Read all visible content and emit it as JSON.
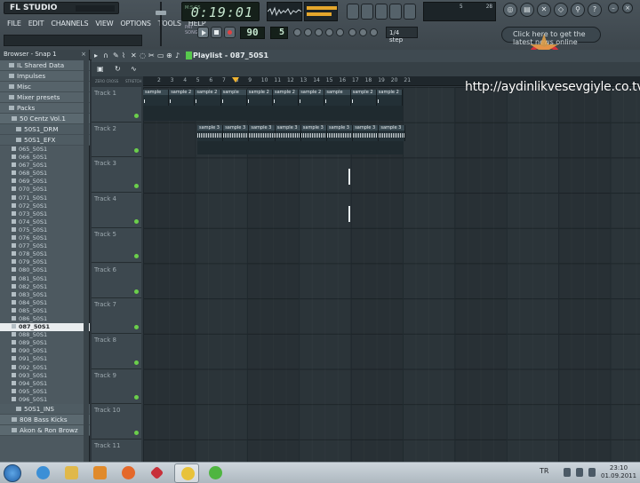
{
  "app": {
    "logo_text": "FL STUDIO",
    "menus": [
      "FILE",
      "EDIT",
      "CHANNELS",
      "VIEW",
      "OPTIONS",
      "TOOLS",
      "HELP"
    ]
  },
  "transport": {
    "song_time": "0:19:01",
    "song_time_label": "M:S:CS",
    "tempo": "90",
    "pattern": "5",
    "snap": "1/4 step",
    "monitor_left": "5",
    "monitor_right": "28",
    "pattern_mode_label": "PAT SONG",
    "online_text": "Click here to get the latest news online"
  },
  "browser": {
    "title": "Browser - Snap 1",
    "items": [
      {
        "label": "IL Shared Data",
        "kind": "folder"
      },
      {
        "label": "Impulses",
        "kind": "folder"
      },
      {
        "label": "Misc",
        "kind": "folder"
      },
      {
        "label": "Mixer presets",
        "kind": "folder"
      },
      {
        "label": "Packs",
        "kind": "folder"
      },
      {
        "label": "50 Centz Vol.1",
        "kind": "pack"
      },
      {
        "label": "50S1_DRM",
        "kind": "sub"
      },
      {
        "label": "50S1_EFX",
        "kind": "sub"
      },
      {
        "label": "065_50S1",
        "kind": "file"
      },
      {
        "label": "066_50S1",
        "kind": "file"
      },
      {
        "label": "067_50S1",
        "kind": "file"
      },
      {
        "label": "068_50S1",
        "kind": "file"
      },
      {
        "label": "069_50S1",
        "kind": "file"
      },
      {
        "label": "070_50S1",
        "kind": "file"
      },
      {
        "label": "071_50S1",
        "kind": "file"
      },
      {
        "label": "072_50S1",
        "kind": "file"
      },
      {
        "label": "073_50S1",
        "kind": "file"
      },
      {
        "label": "074_50S1",
        "kind": "file"
      },
      {
        "label": "075_50S1",
        "kind": "file"
      },
      {
        "label": "076_50S1",
        "kind": "file"
      },
      {
        "label": "077_50S1",
        "kind": "file"
      },
      {
        "label": "078_50S1",
        "kind": "file"
      },
      {
        "label": "079_50S1",
        "kind": "file"
      },
      {
        "label": "080_50S1",
        "kind": "file"
      },
      {
        "label": "081_50S1",
        "kind": "file"
      },
      {
        "label": "082_50S1",
        "kind": "file"
      },
      {
        "label": "083_50S1",
        "kind": "file"
      },
      {
        "label": "084_50S1",
        "kind": "file"
      },
      {
        "label": "085_50S1",
        "kind": "file"
      },
      {
        "label": "086_50S1",
        "kind": "file"
      },
      {
        "label": "087_50S1",
        "kind": "selected"
      },
      {
        "label": "088_50S1",
        "kind": "file"
      },
      {
        "label": "089_50S1",
        "kind": "file"
      },
      {
        "label": "090_50S1",
        "kind": "file"
      },
      {
        "label": "091_50S1",
        "kind": "file"
      },
      {
        "label": "092_50S1",
        "kind": "file"
      },
      {
        "label": "093_50S1",
        "kind": "file"
      },
      {
        "label": "094_50S1",
        "kind": "file"
      },
      {
        "label": "095_50S1",
        "kind": "file"
      },
      {
        "label": "096_50S1",
        "kind": "file"
      },
      {
        "label": "50S1_INS",
        "kind": "sub"
      },
      {
        "label": "808 Bass Kicks",
        "kind": "pack"
      },
      {
        "label": "Akon & Ron Browz",
        "kind": "pack"
      }
    ]
  },
  "playlist": {
    "title": "Playlist - 087_50S1",
    "zero_cross_label": "ZERO CROSS",
    "stretch_label": "STRETCH",
    "bars": [
      "2",
      "3",
      "4",
      "5",
      "6",
      "7",
      "8",
      "9",
      "10",
      "11",
      "12",
      "13",
      "14",
      "15",
      "16",
      "17",
      "18",
      "19",
      "20",
      "21"
    ],
    "tracks": [
      "Track 1",
      "Track 2",
      "Track 3",
      "Track 4",
      "Track 5",
      "Track 6",
      "Track 7",
      "Track 8",
      "Track 9",
      "Track 10",
      "Track 11"
    ],
    "track1_clip_label": "sample",
    "track1_clip_labels": [
      "sample",
      "sample 2",
      "sample 2",
      "sample",
      "sample 2",
      "sample 2",
      "sample 2",
      "sample",
      "sample 2",
      "sample",
      "sample 2",
      "sample 2",
      "sample 2",
      "sample 3",
      "sample 3",
      "sample 3",
      "sample 3",
      "sample 3",
      "sample 3",
      "sample 3"
    ],
    "track1_clips_shown": [
      "sample",
      "sample 2",
      "sample 2",
      "sample",
      "sample 2",
      "sample 2",
      "sample 2",
      "sample",
      "sample 2",
      "sample 2",
      "sample 2",
      "sample",
      "sample 2",
      "sample",
      "sample 2",
      "sample 2",
      "sample 2",
      "sample 2",
      "sample 5",
      "sample 5"
    ],
    "track2_clip_label": "sample 3"
  },
  "overlay": {
    "url": "http://aydinlikvesevgiyle.co.tv"
  },
  "taskbar": {
    "lang": "TR",
    "time": "23:10",
    "date": "01.09.2011"
  },
  "colors": {
    "accent_play": "#57c84d",
    "playhead": "#f0b330",
    "cpu_meter": "#e5a72c",
    "background": "#2b3339"
  }
}
